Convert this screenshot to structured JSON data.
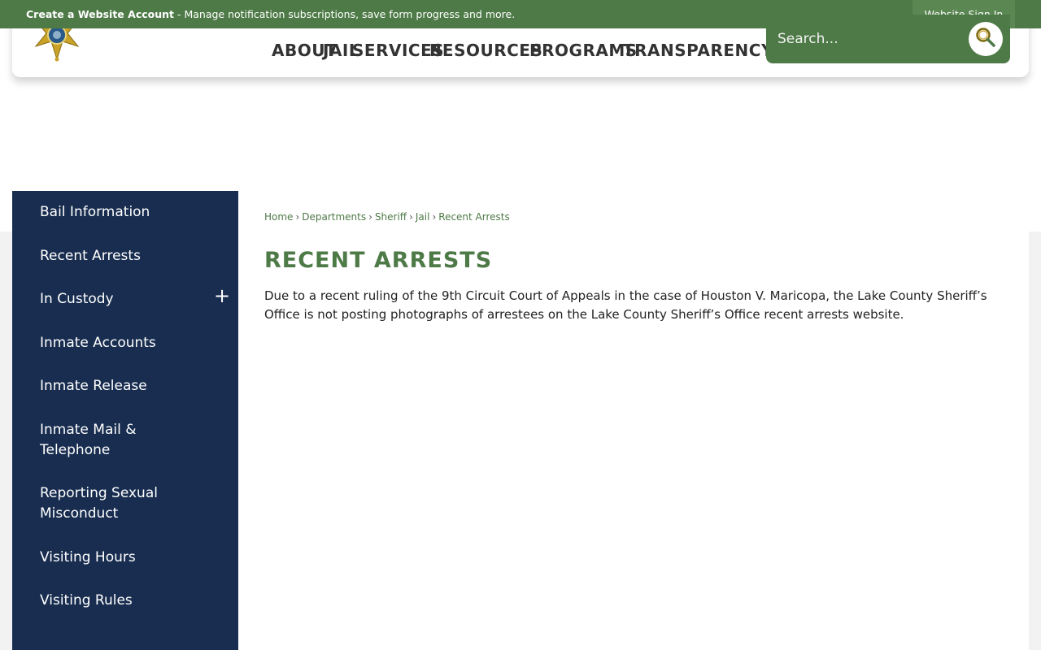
{
  "topbar": {
    "account_link": "Create a Website Account",
    "account_desc": " - Manage notification subscriptions, save form progress and more.",
    "signin": "Website Sign In"
  },
  "nav": [
    "ABOUT",
    "JAIL",
    "SERVICES",
    "RESOURCES",
    "PROGRAMS",
    "TRANSPARENCY"
  ],
  "search": {
    "placeholder": "Search..."
  },
  "sidebar": {
    "items": [
      "Bail Information",
      "Recent Arrests",
      "In Custody",
      "Inmate Accounts",
      "Inmate Release",
      "Inmate Mail & Telephone",
      "Reporting Sexual Misconduct",
      "Visiting Hours",
      "Visiting Rules"
    ],
    "expand_symbol": "+"
  },
  "breadcrumb": [
    "Home",
    "Departments",
    "Sheriff",
    "Jail",
    "Recent Arrests"
  ],
  "breadcrumb_sep": "›",
  "page": {
    "title": "RECENT ARRESTS",
    "body": "Due to a recent ruling of the 9th Circuit Court of Appeals in the case of Houston V. Maricopa, the Lake County Sheriff’s Office is not posting photographs of arrestees on the Lake County Sheriff’s Office recent arrests website."
  },
  "colors": {
    "green": "#4e7a47",
    "navy": "#182d4f",
    "gold": "#c9a227"
  }
}
